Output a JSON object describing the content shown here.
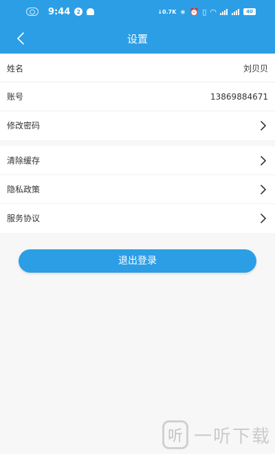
{
  "status_bar": {
    "time": "9:44",
    "notification_count": "2",
    "net_speed": "0.7K",
    "battery": "40"
  },
  "header": {
    "title": "设置"
  },
  "settings": {
    "account": [
      {
        "label": "姓名",
        "value": "刘贝贝"
      },
      {
        "label": "账号",
        "value": "13869884671"
      },
      {
        "label": "修改密码"
      }
    ],
    "misc": [
      {
        "label": "清除缓存"
      },
      {
        "label": "隐私政策"
      },
      {
        "label": "服务协议"
      }
    ]
  },
  "logout_label": "退出登录",
  "watermark": {
    "logo_char": "听",
    "text": "一听下载"
  },
  "colors": {
    "primary": "#2c9ee6",
    "background": "#f7f7f7"
  }
}
